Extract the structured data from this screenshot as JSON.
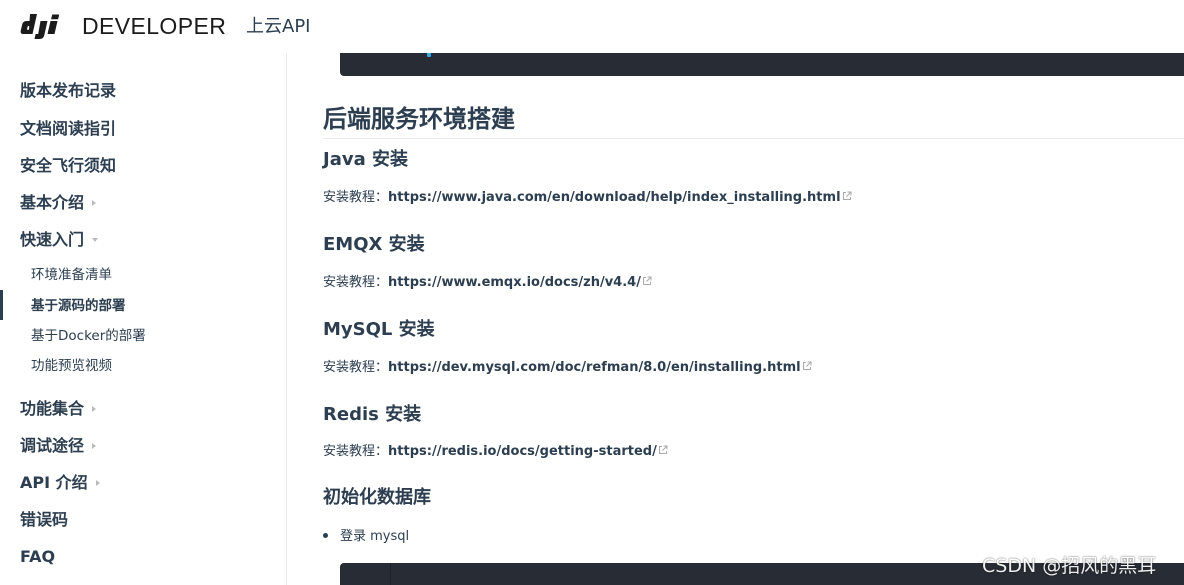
{
  "header": {
    "logo_text": "DEVELOPER",
    "site_title": "上云API"
  },
  "sidebar": {
    "items": [
      {
        "label": "版本发布记录"
      },
      {
        "label": "文档阅读指引"
      },
      {
        "label": "安全飞行须知"
      },
      {
        "label": "基本介绍",
        "arrow": "right"
      },
      {
        "label": "快速入门",
        "arrow": "down"
      },
      {
        "label": "功能集合",
        "arrow": "right"
      },
      {
        "label": "调试途径",
        "arrow": "right"
      },
      {
        "label": "API 介绍",
        "arrow": "right"
      },
      {
        "label": "错误码"
      },
      {
        "label": "FAQ"
      }
    ],
    "subitems": [
      {
        "label": "环境准备清单"
      },
      {
        "label": "基于源码的部署",
        "active": true
      },
      {
        "label": "基于Docker的部署"
      },
      {
        "label": "功能预览视频"
      }
    ]
  },
  "content": {
    "h2": "后端服务环境搭建",
    "sections": [
      {
        "title": "Java 安装",
        "label": "安装教程：",
        "link": "https://www.java.com/en/download/help/index_installing.html"
      },
      {
        "title": "EMQX 安装",
        "label": "安装教程：",
        "link": "https://www.emqx.io/docs/zh/v4.4/"
      },
      {
        "title": "MySQL 安装",
        "label": "安装教程：",
        "link": "https://dev.mysql.com/doc/refman/8.0/en/installing.html"
      },
      {
        "title": "Redis 安装",
        "label": "安装教程：",
        "link": "https://redis.io/docs/getting-started/"
      }
    ],
    "db_title": "初始化数据库",
    "list_item": "登录 mysql"
  },
  "watermark": "CSDN @招风的黑耳",
  "colors": {
    "text": "#2c3e50",
    "code_bg": "#282c34",
    "border": "#eaecef"
  }
}
